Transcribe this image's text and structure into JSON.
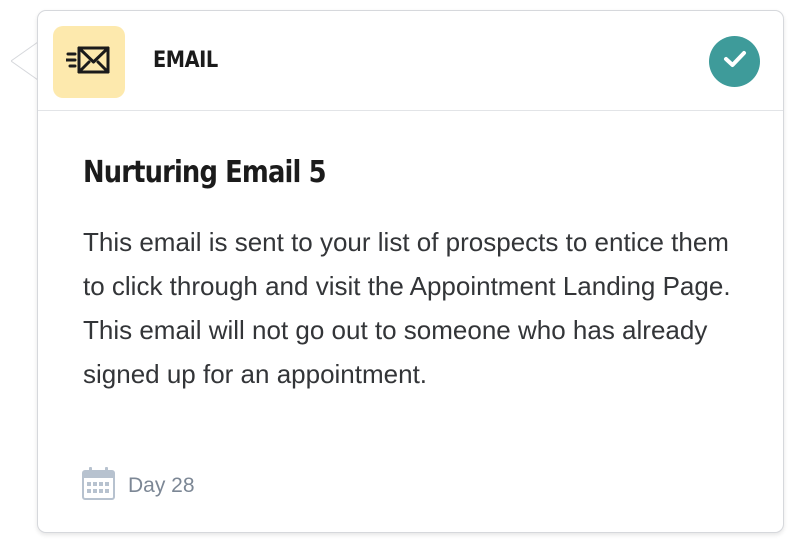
{
  "step": {
    "type_label": "EMAIL",
    "type_icon": "envelope-fast-icon",
    "status_icon": "check-circle-icon",
    "title": "Nurturing Email 5",
    "description": "This email is sent to your list of prospects to entice them to click through and visit the Appointment Landing Page. This email will not go out to someone who has already signed up for an appointment.",
    "schedule_icon": "calendar-icon",
    "schedule_label": "Day 28"
  },
  "colors": {
    "icon_tile": "#fde9ad",
    "check_badge": "#3e9b9a",
    "muted_text": "#7c8795",
    "border": "#d6d8dc"
  }
}
